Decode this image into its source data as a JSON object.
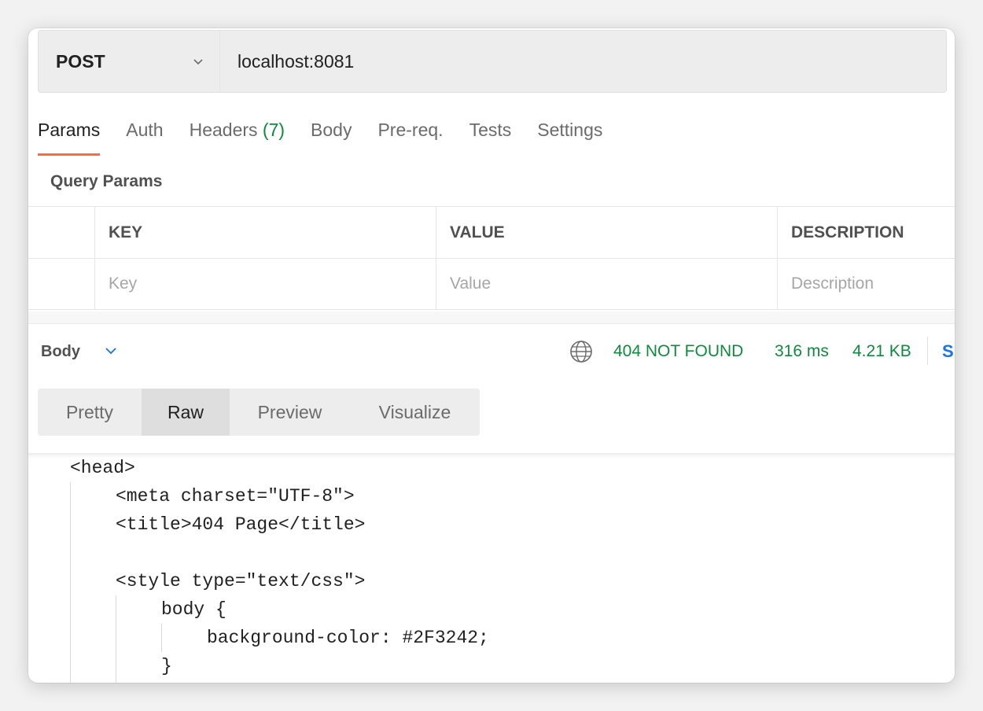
{
  "request": {
    "method": "POST",
    "url": "localhost:8081"
  },
  "tabs": [
    {
      "label": "Params",
      "active": true
    },
    {
      "label": "Auth"
    },
    {
      "label": "Headers",
      "count": "(7)"
    },
    {
      "label": "Body"
    },
    {
      "label": "Pre-req."
    },
    {
      "label": "Tests"
    },
    {
      "label": "Settings"
    }
  ],
  "query_params": {
    "title": "Query Params",
    "headers": [
      "KEY",
      "VALUE",
      "DESCRIPTION"
    ],
    "placeholders": [
      "Key",
      "Value",
      "Description"
    ]
  },
  "response": {
    "section_label": "Body",
    "status": "404 NOT FOUND",
    "time": "316 ms",
    "size": "4.21 KB",
    "save_label_visible": "S",
    "status_color": "#0f8a3e",
    "icons": {
      "network": "globe-icon",
      "expand": "chevron-down-icon"
    }
  },
  "view_modes": [
    {
      "label": "Pretty"
    },
    {
      "label": "Raw",
      "active": true
    },
    {
      "label": "Preview"
    },
    {
      "label": "Visualize"
    }
  ],
  "code_lines": [
    "<head>",
    "<meta charset=\"UTF-8\">",
    "<title>404 Page</title>",
    "",
    "<style type=\"text/css\">",
    "body {",
    "background-color: #2F3242;",
    "}"
  ],
  "colors": {
    "accent": "#ff6c37",
    "link": "#1a73e8"
  }
}
